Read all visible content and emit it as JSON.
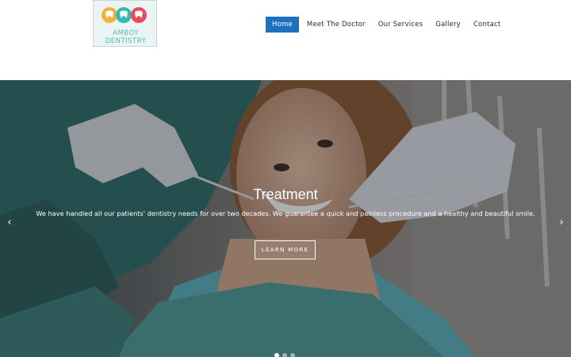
{
  "header": {
    "logo": {
      "text": "AMBOY DENTISTRY",
      "icon": "three-teeth-logo-icon",
      "tooth_colors": [
        "#f2b23a",
        "#35b9b0",
        "#e8495f"
      ]
    },
    "nav": {
      "items": [
        {
          "label": "Home",
          "active": true
        },
        {
          "label": "Meet The Doctor",
          "active": false
        },
        {
          "label": "Our Services",
          "active": false
        },
        {
          "label": "Gallery",
          "active": false
        },
        {
          "label": "Contact",
          "active": false
        }
      ],
      "active_color": "#1e6fc0"
    }
  },
  "hero": {
    "title": "Treatment",
    "text": "We have handled all our patients' dentistry needs for over two decades. We guarantee a quick and painless procedure and a healthy and beautiful smile.",
    "button_label": "LEARN MORE",
    "prev_icon": "chevron-left-icon",
    "next_icon": "chevron-right-icon",
    "prev_glyph": "‹",
    "next_glyph": "›",
    "slide_count": 3,
    "active_slide": 1
  }
}
